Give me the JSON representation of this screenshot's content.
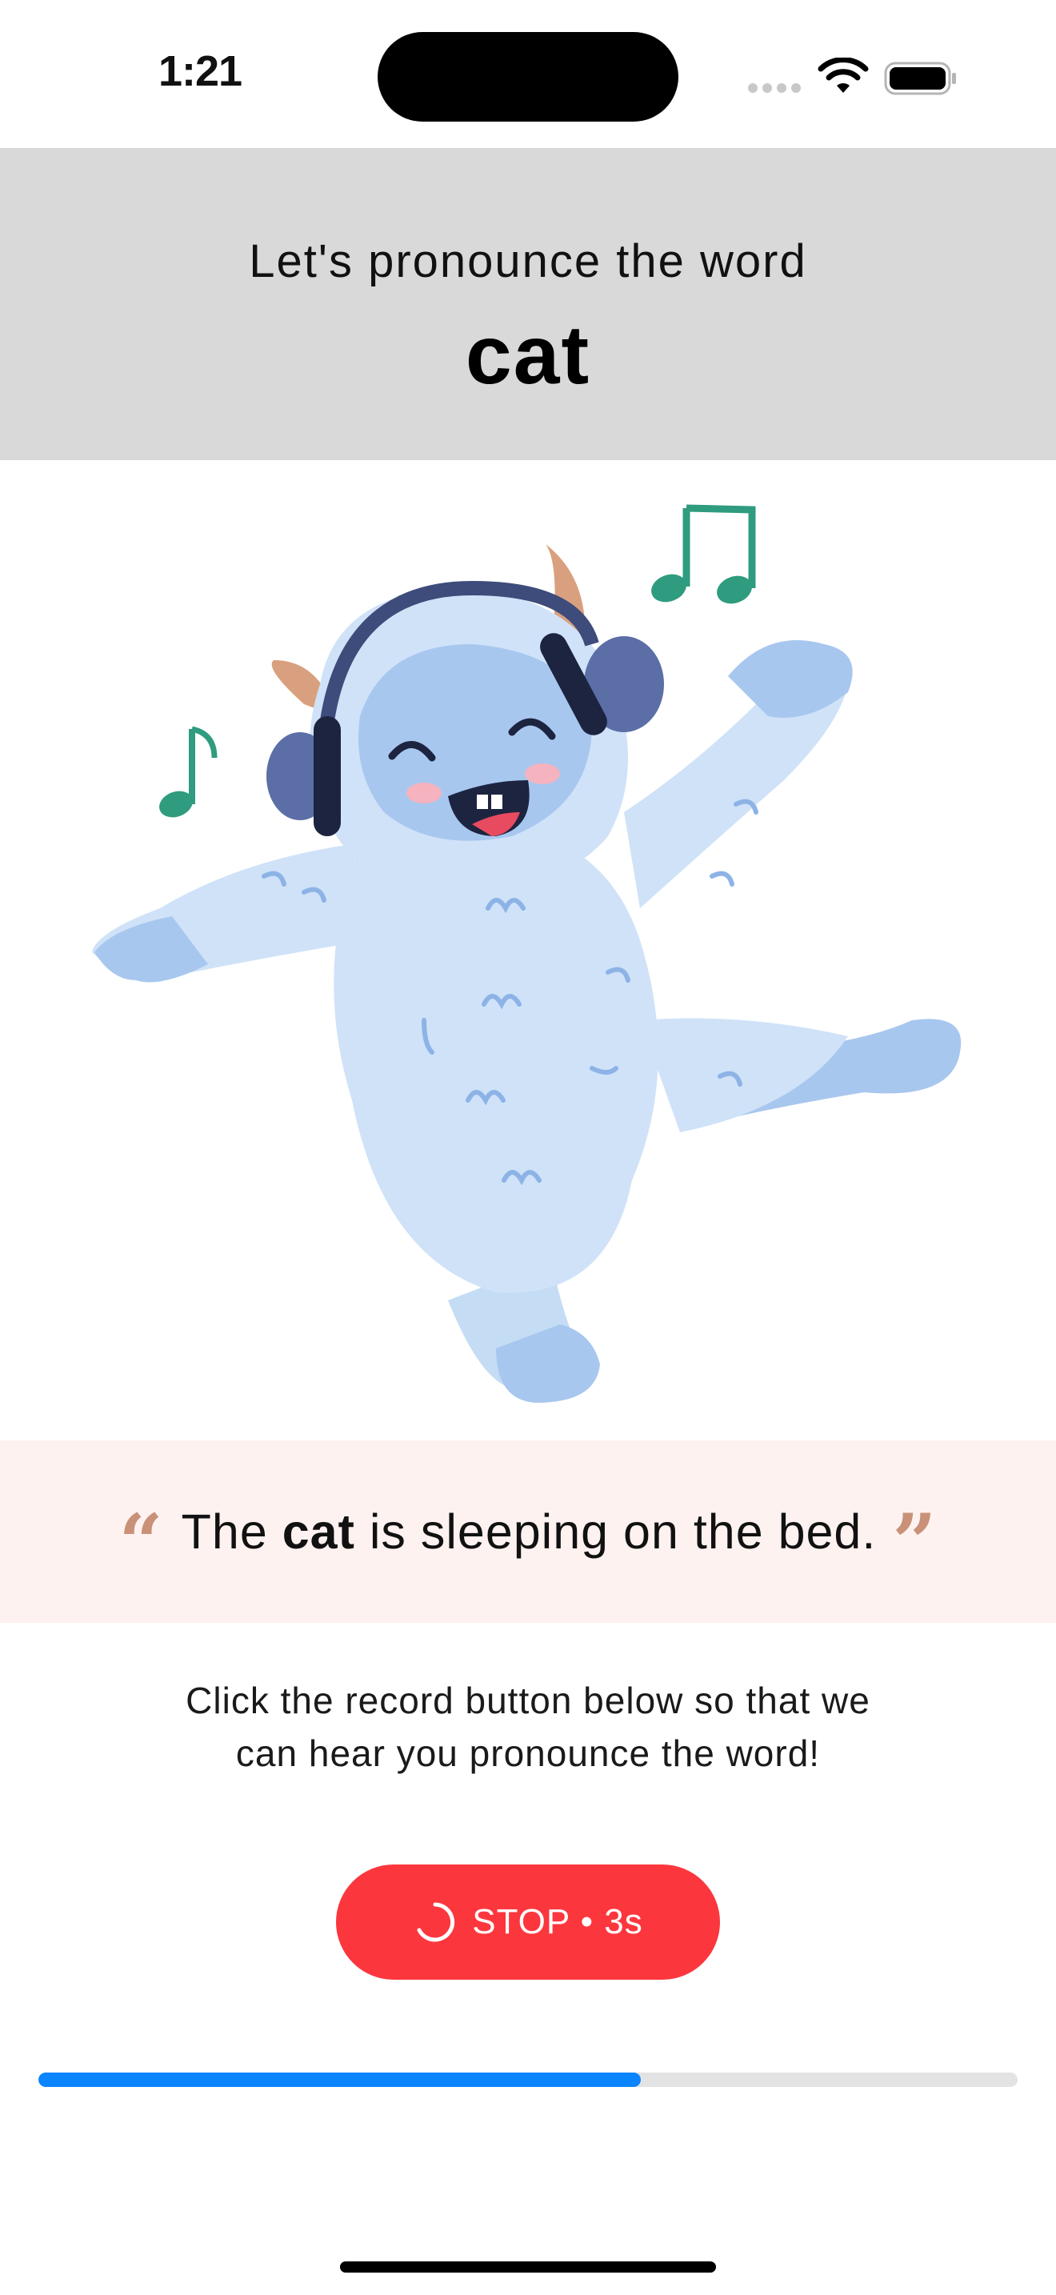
{
  "status_bar": {
    "time": "1:21",
    "icons": [
      "cellular-signal-icon",
      "wifi-icon",
      "battery-icon"
    ]
  },
  "header": {
    "subtitle": "Let's pronounce the word",
    "word": "cat"
  },
  "illustration": {
    "name": "dancing-yeti-with-headphones",
    "icons": [
      "music-note-icon",
      "double-music-note-icon"
    ]
  },
  "sentence": {
    "before": "The ",
    "highlight": "cat",
    "after": " is sleeping on the bed."
  },
  "instruction": {
    "line1": "Click the record button below so that we",
    "line2": "can hear you pronounce the word!"
  },
  "stop_button": {
    "label": "STOP • 3s",
    "icon": "loading-spinner-icon"
  },
  "progress": {
    "fraction": 0.615
  },
  "colors": {
    "header_bg": "#d9d9d9",
    "banner_bg": "#fdf2f0",
    "quote": "#c99178",
    "button": "#fc363d",
    "progress_fill": "#0a84ff",
    "progress_track": "#e3e3e3",
    "note": "#2f9b7f"
  }
}
